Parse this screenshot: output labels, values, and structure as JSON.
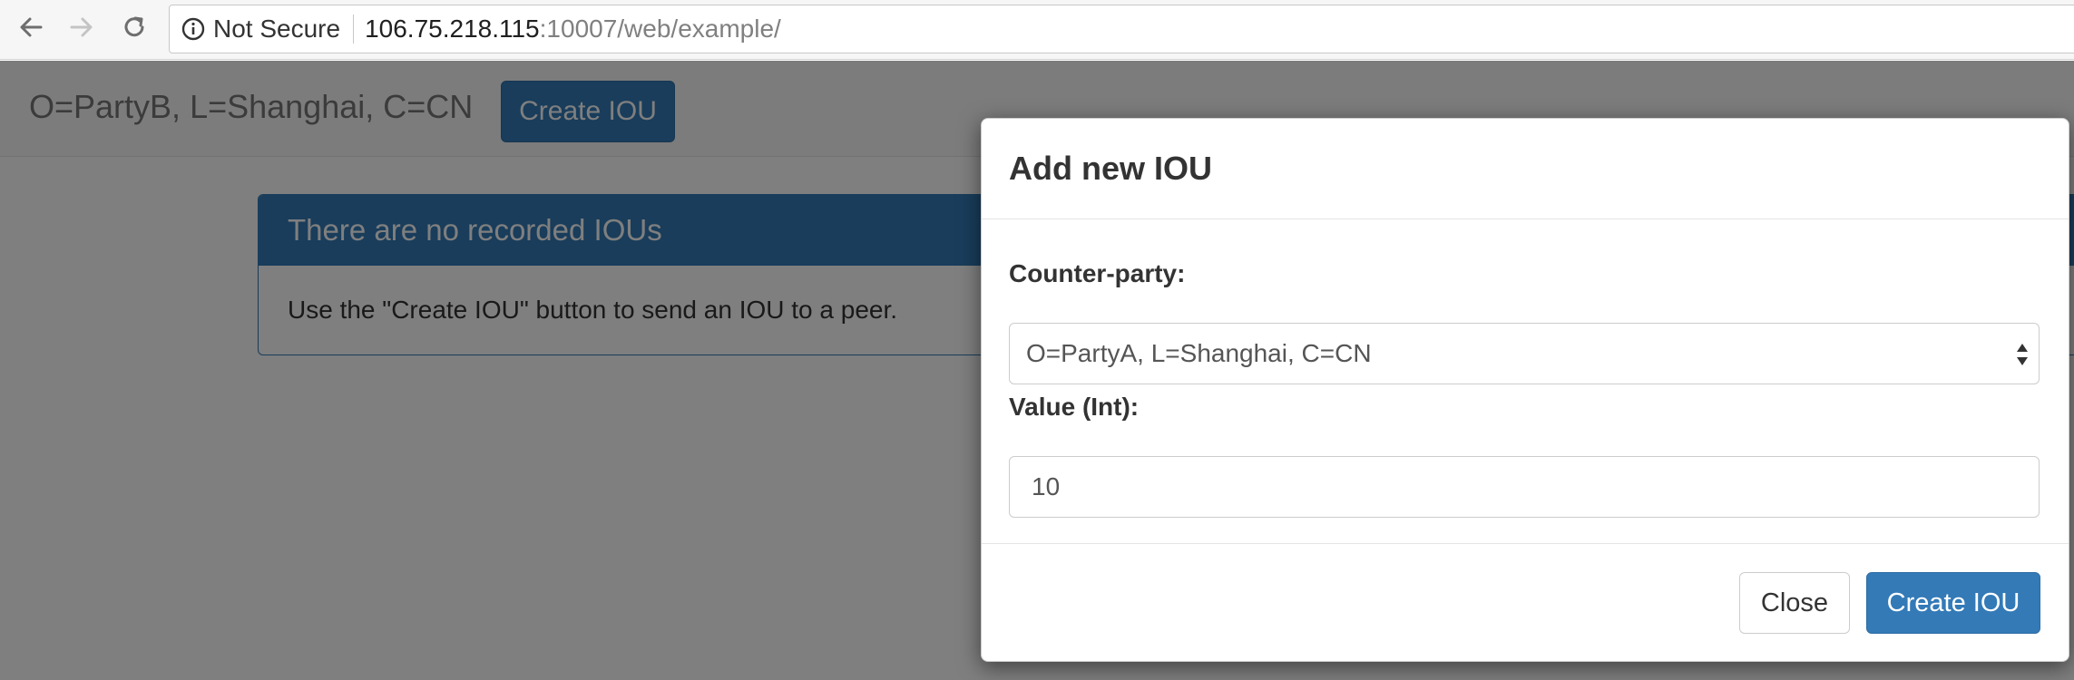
{
  "browser": {
    "security_label": "Not Secure",
    "url_host": "106.75.218.115",
    "url_path": ":10007/web/example/"
  },
  "navbar": {
    "brand": "O=PartyB, L=Shanghai, C=CN",
    "create_button": "Create IOU"
  },
  "panel": {
    "heading": "There are no recorded IOUs",
    "body": "Use the \"Create IOU\" button to send an IOU to a peer."
  },
  "modal": {
    "title": "Add new IOU",
    "counterparty_label": "Counter-party:",
    "counterparty_value": "O=PartyA, L=Shanghai, C=CN",
    "value_label": "Value (Int):",
    "value_input": "10",
    "close_button": "Close",
    "create_button": "Create IOU"
  },
  "colors": {
    "primary": "#337ab7",
    "backdrop": "rgba(0,0,0,0.5)"
  },
  "icons": [
    "arrow-left-icon",
    "arrow-right-icon",
    "reload-icon",
    "info-icon",
    "select-arrows-icon"
  ]
}
